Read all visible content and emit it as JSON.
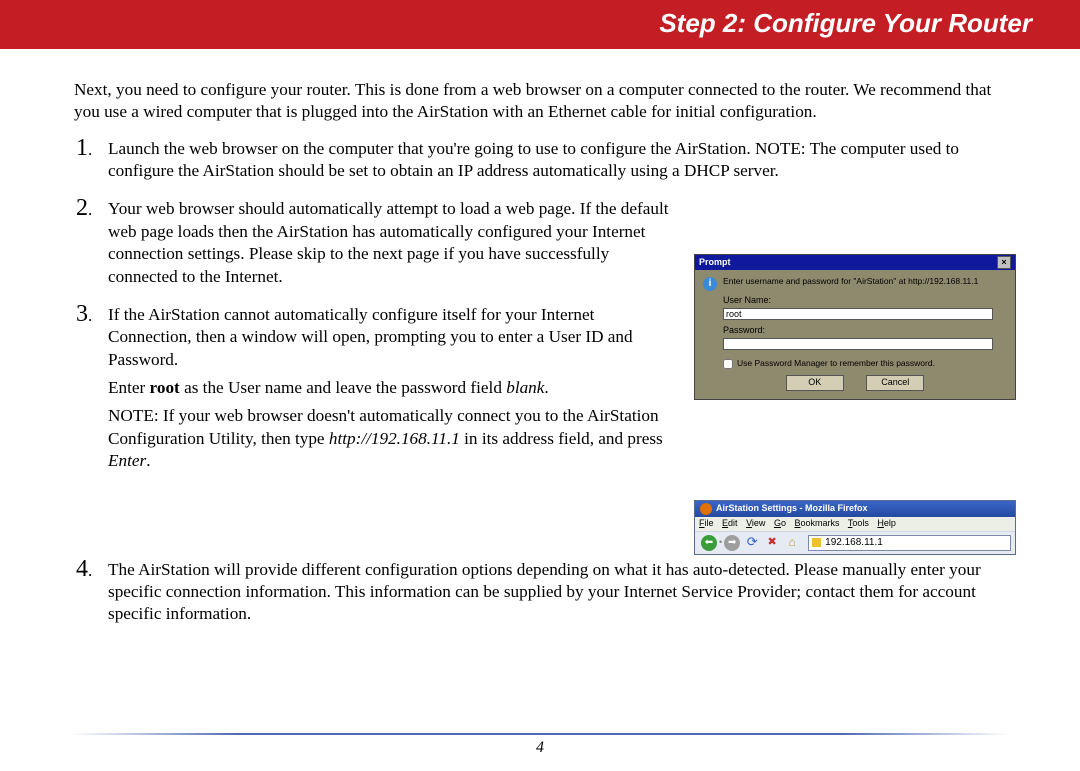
{
  "header": {
    "title": "Step 2:  Configure Your Router"
  },
  "intro": "Next, you need to configure your router.  This is done from a web browser on a computer connected to the router.  We recommend that you use a wired computer that is plugged into the AirStation with an Ethernet cable for initial configuration.",
  "steps": {
    "s1": {
      "num": "1",
      "text": "Launch the web browser on the computer that you're going to use to configure the AirStation.  NOTE:  The computer used to configure the AirStation should be set to obtain an IP address automatically using a DHCP server."
    },
    "s2": {
      "num": "2",
      "text": "Your web browser should automatically attempt to load a web page.  If the default web page loads then the AirStation has automatically configured your Internet connection settings.  Please skip to the next page if you have successfully connected to the Internet."
    },
    "s3": {
      "num": "3",
      "p1": "If the AirStation cannot automatically configure itself for your Internet Connection, then a window will open, prompting you to enter a User ID and Password.",
      "p2a": "Enter ",
      "p2b": "root",
      "p2c": " as the User name and leave the password field ",
      "p2d": "blank",
      "p2e": ".",
      "p3a": "NOTE:  If your web browser doesn't automatically connect you to the AirStation Configuration Utility, then type ",
      "p3b": "http://192.168.11.1",
      "p3c": " in its address field, and press ",
      "p3d": "Enter",
      "p3e": "."
    },
    "s4": {
      "num": "4",
      "text": "The AirStation will provide different configuration options depending on what it has auto-detected.  Please manually enter your specific connection information.  This information can be supplied by your Internet Service Provider; contact them for account specific information."
    }
  },
  "prompt": {
    "title": "Prompt",
    "msg": "Enter username and password for \"AirStation\" at http://192.168.11.1",
    "user_label": "User Name:",
    "user_value": "root",
    "pass_label": "Password:",
    "remember": "Use Password Manager to remember this password.",
    "ok": "OK",
    "cancel": "Cancel"
  },
  "browser": {
    "title": "AirStation Settings - Mozilla Firefox",
    "menu": {
      "file": "File",
      "edit": "Edit",
      "view": "View",
      "go": "Go",
      "bookmarks": "Bookmarks",
      "tools": "Tools",
      "help": "Help"
    },
    "address": "192.168.11.1"
  },
  "page_number": "4"
}
